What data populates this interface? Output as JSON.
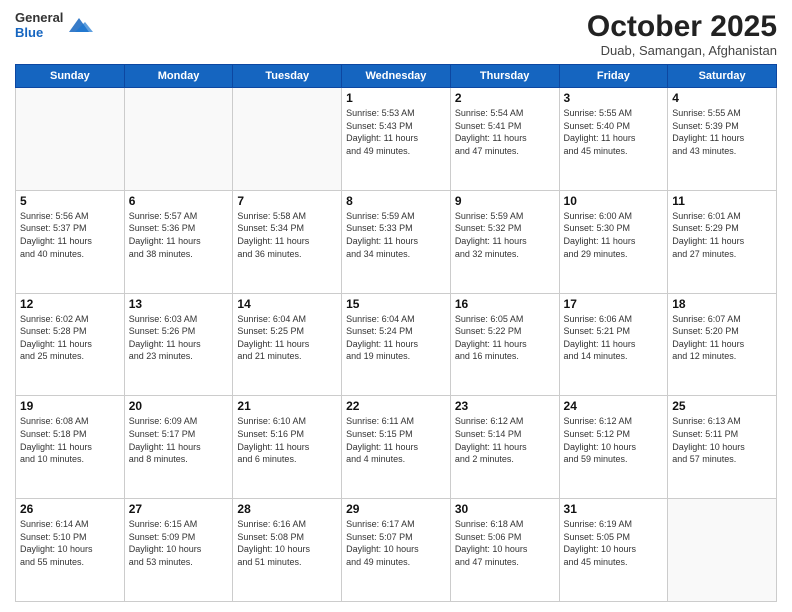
{
  "header": {
    "logo_general": "General",
    "logo_blue": "Blue",
    "month_title": "October 2025",
    "location": "Duab, Samangan, Afghanistan"
  },
  "weekdays": [
    "Sunday",
    "Monday",
    "Tuesday",
    "Wednesday",
    "Thursday",
    "Friday",
    "Saturday"
  ],
  "rows": [
    [
      {
        "day": "",
        "info": ""
      },
      {
        "day": "",
        "info": ""
      },
      {
        "day": "",
        "info": ""
      },
      {
        "day": "1",
        "info": "Sunrise: 5:53 AM\nSunset: 5:43 PM\nDaylight: 11 hours\nand 49 minutes."
      },
      {
        "day": "2",
        "info": "Sunrise: 5:54 AM\nSunset: 5:41 PM\nDaylight: 11 hours\nand 47 minutes."
      },
      {
        "day": "3",
        "info": "Sunrise: 5:55 AM\nSunset: 5:40 PM\nDaylight: 11 hours\nand 45 minutes."
      },
      {
        "day": "4",
        "info": "Sunrise: 5:55 AM\nSunset: 5:39 PM\nDaylight: 11 hours\nand 43 minutes."
      }
    ],
    [
      {
        "day": "5",
        "info": "Sunrise: 5:56 AM\nSunset: 5:37 PM\nDaylight: 11 hours\nand 40 minutes."
      },
      {
        "day": "6",
        "info": "Sunrise: 5:57 AM\nSunset: 5:36 PM\nDaylight: 11 hours\nand 38 minutes."
      },
      {
        "day": "7",
        "info": "Sunrise: 5:58 AM\nSunset: 5:34 PM\nDaylight: 11 hours\nand 36 minutes."
      },
      {
        "day": "8",
        "info": "Sunrise: 5:59 AM\nSunset: 5:33 PM\nDaylight: 11 hours\nand 34 minutes."
      },
      {
        "day": "9",
        "info": "Sunrise: 5:59 AM\nSunset: 5:32 PM\nDaylight: 11 hours\nand 32 minutes."
      },
      {
        "day": "10",
        "info": "Sunrise: 6:00 AM\nSunset: 5:30 PM\nDaylight: 11 hours\nand 29 minutes."
      },
      {
        "day": "11",
        "info": "Sunrise: 6:01 AM\nSunset: 5:29 PM\nDaylight: 11 hours\nand 27 minutes."
      }
    ],
    [
      {
        "day": "12",
        "info": "Sunrise: 6:02 AM\nSunset: 5:28 PM\nDaylight: 11 hours\nand 25 minutes."
      },
      {
        "day": "13",
        "info": "Sunrise: 6:03 AM\nSunset: 5:26 PM\nDaylight: 11 hours\nand 23 minutes."
      },
      {
        "day": "14",
        "info": "Sunrise: 6:04 AM\nSunset: 5:25 PM\nDaylight: 11 hours\nand 21 minutes."
      },
      {
        "day": "15",
        "info": "Sunrise: 6:04 AM\nSunset: 5:24 PM\nDaylight: 11 hours\nand 19 minutes."
      },
      {
        "day": "16",
        "info": "Sunrise: 6:05 AM\nSunset: 5:22 PM\nDaylight: 11 hours\nand 16 minutes."
      },
      {
        "day": "17",
        "info": "Sunrise: 6:06 AM\nSunset: 5:21 PM\nDaylight: 11 hours\nand 14 minutes."
      },
      {
        "day": "18",
        "info": "Sunrise: 6:07 AM\nSunset: 5:20 PM\nDaylight: 11 hours\nand 12 minutes."
      }
    ],
    [
      {
        "day": "19",
        "info": "Sunrise: 6:08 AM\nSunset: 5:18 PM\nDaylight: 11 hours\nand 10 minutes."
      },
      {
        "day": "20",
        "info": "Sunrise: 6:09 AM\nSunset: 5:17 PM\nDaylight: 11 hours\nand 8 minutes."
      },
      {
        "day": "21",
        "info": "Sunrise: 6:10 AM\nSunset: 5:16 PM\nDaylight: 11 hours\nand 6 minutes."
      },
      {
        "day": "22",
        "info": "Sunrise: 6:11 AM\nSunset: 5:15 PM\nDaylight: 11 hours\nand 4 minutes."
      },
      {
        "day": "23",
        "info": "Sunrise: 6:12 AM\nSunset: 5:14 PM\nDaylight: 11 hours\nand 2 minutes."
      },
      {
        "day": "24",
        "info": "Sunrise: 6:12 AM\nSunset: 5:12 PM\nDaylight: 10 hours\nand 59 minutes."
      },
      {
        "day": "25",
        "info": "Sunrise: 6:13 AM\nSunset: 5:11 PM\nDaylight: 10 hours\nand 57 minutes."
      }
    ],
    [
      {
        "day": "26",
        "info": "Sunrise: 6:14 AM\nSunset: 5:10 PM\nDaylight: 10 hours\nand 55 minutes."
      },
      {
        "day": "27",
        "info": "Sunrise: 6:15 AM\nSunset: 5:09 PM\nDaylight: 10 hours\nand 53 minutes."
      },
      {
        "day": "28",
        "info": "Sunrise: 6:16 AM\nSunset: 5:08 PM\nDaylight: 10 hours\nand 51 minutes."
      },
      {
        "day": "29",
        "info": "Sunrise: 6:17 AM\nSunset: 5:07 PM\nDaylight: 10 hours\nand 49 minutes."
      },
      {
        "day": "30",
        "info": "Sunrise: 6:18 AM\nSunset: 5:06 PM\nDaylight: 10 hours\nand 47 minutes."
      },
      {
        "day": "31",
        "info": "Sunrise: 6:19 AM\nSunset: 5:05 PM\nDaylight: 10 hours\nand 45 minutes."
      },
      {
        "day": "",
        "info": ""
      }
    ]
  ]
}
